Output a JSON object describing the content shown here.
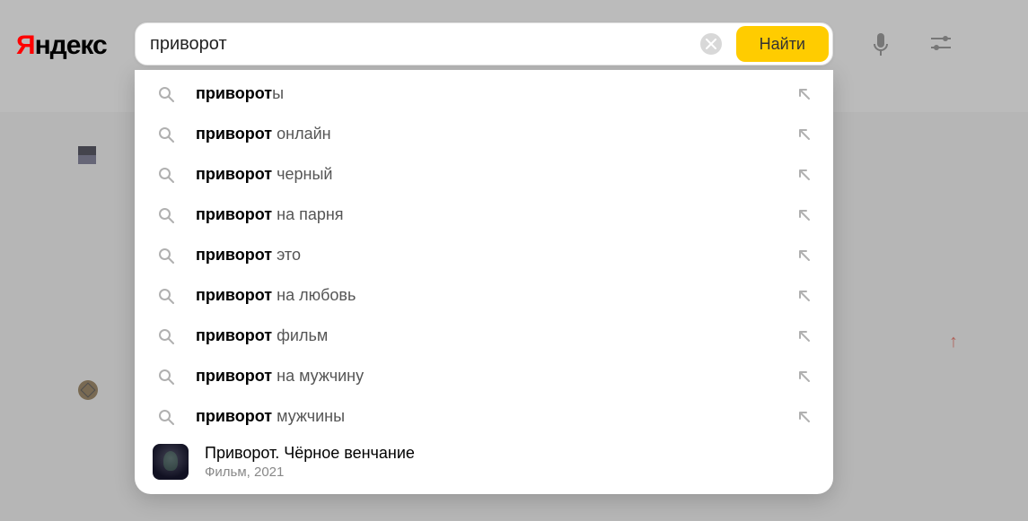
{
  "logo": {
    "first": "Я",
    "rest": "ндекс"
  },
  "search": {
    "value": "приворот",
    "placeholder": "",
    "button_label": "Найти"
  },
  "suggestions": [
    {
      "bold": "приворот",
      "rest": "ы"
    },
    {
      "bold": "приворот",
      "rest": " онлайн"
    },
    {
      "bold": "приворот",
      "rest": " черный"
    },
    {
      "bold": "приворот",
      "rest": " на парня"
    },
    {
      "bold": "приворот",
      "rest": " это"
    },
    {
      "bold": "приворот",
      "rest": " на любовь"
    },
    {
      "bold": "приворот",
      "rest": " фильм"
    },
    {
      "bold": "приворот",
      "rest": " на мужчину"
    },
    {
      "bold": "приворот",
      "rest": " мужчины"
    }
  ],
  "rich": {
    "title": "Приворот. Чёрное венчание",
    "subtitle": "Фильм, 2021"
  },
  "icons": {
    "mic": "mic-icon",
    "settings": "settings-icon",
    "clear": "clear-icon",
    "search": "search-icon",
    "insert": "insert-arrow-icon"
  }
}
